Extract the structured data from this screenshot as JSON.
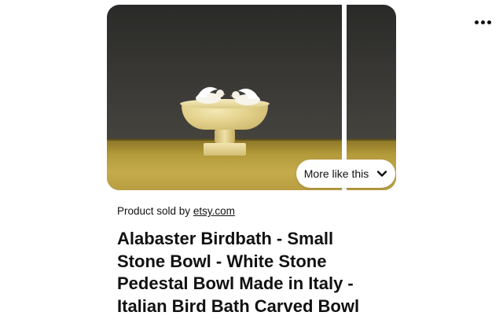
{
  "menu": {
    "icon": "more-horizontal-icon"
  },
  "pin": {
    "more_like_this_label": "More like this",
    "chevron_icon": "chevron-down-icon"
  },
  "product": {
    "sold_by_prefix": "Product sold by",
    "sold_by_link": "etsy.com",
    "title": "Alabaster Birdbath - Small Stone Bowl - White Stone Pedestal Bowl Made in Italy - Italian Bird Bath Carved Bowl"
  }
}
